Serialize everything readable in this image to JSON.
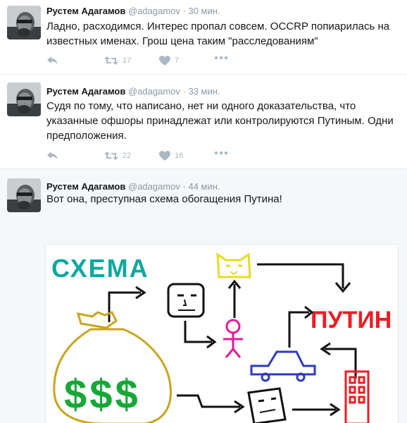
{
  "tweets": [
    {
      "author": "Рустем Адагамов",
      "handle": "@adagamov",
      "separator": "·",
      "time": "30 мин.",
      "text": "Ладно, расходимся. Интерес пропал совсем. OCCRP попиарилась на известных именах. Грош цена таким \"расследованиям\"",
      "retweets": "17",
      "likes": "7"
    },
    {
      "author": "Рустем Адагамов",
      "handle": "@adagamov",
      "separator": "·",
      "time": "33 мин.",
      "text": "Судя по тому, что написано, нет ни одного доказательства, что указанные офшоры принадлежат или контролируются Путиным. Одни предположения.",
      "retweets": "22",
      "likes": "16"
    },
    {
      "author": "Рустем Адагамов",
      "handle": "@adagamov",
      "separator": "·",
      "time": "44 мин.",
      "text": "Вот она, преступная схема обогащения Путина!",
      "image": {
        "label_schema": "СХЕМА",
        "label_putin": "ПУТИН",
        "money_symbols": "$$$"
      }
    }
  ],
  "colors": {
    "name": "#14171a",
    "meta": "#8899a6",
    "action_icon": "#aab8c2",
    "expanded_bg": "#f5f8fa",
    "divider": "#e6ecf0"
  },
  "icons": [
    "reply-icon",
    "retweet-icon",
    "like-icon",
    "more-icon"
  ]
}
